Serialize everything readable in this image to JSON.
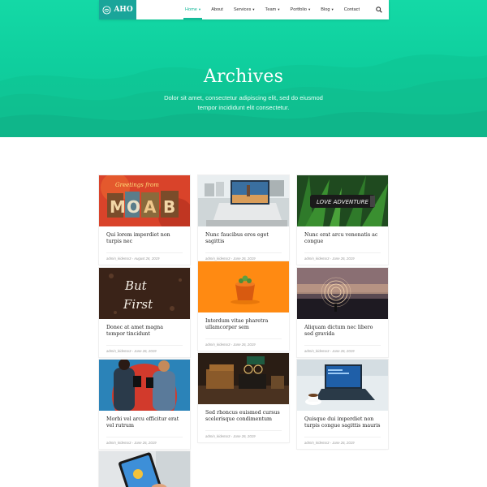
{
  "brand": {
    "name": "AHO",
    "accent": "#1aa59a",
    "hero_color": "#12d09f"
  },
  "nav": {
    "items": [
      {
        "label": "Home",
        "caret": "▾"
      },
      {
        "label": "About",
        "caret": ""
      },
      {
        "label": "Services",
        "caret": "▾"
      },
      {
        "label": "Team",
        "caret": "▾"
      },
      {
        "label": "Portfolio",
        "caret": "▾"
      },
      {
        "label": "Blog",
        "caret": "▾"
      },
      {
        "label": "Contact",
        "caret": ""
      }
    ],
    "active": "Home",
    "search_icon": "search-icon"
  },
  "hero": {
    "title": "Archives",
    "subtitle": "Dolor sit amet, consectetur adipiscing elit, sed do eiusmod tempor incididunt elit consectetur."
  },
  "posts": [
    {
      "title": "Qui lorem imperdiet non turpis nec",
      "meta": "admin_kidemo3 ◦ August 26, 2019",
      "image": "moab-postcard"
    },
    {
      "title": "Nunc faucibus eros eget sagittis",
      "meta": "admin_kidemo3 ◦ June 26, 2019",
      "image": "laptop-city"
    },
    {
      "title": "Nunc erat arcu venenatis ac congue",
      "meta": "admin_kidemo3 ◦ June 26, 2019",
      "image": "bottle-leaves"
    },
    {
      "title": "Donec at amet magna tempor tincidunt",
      "meta": "admin_kidemo3 ◦ June 26, 2019",
      "image": "but-first-coffee"
    },
    {
      "title": "Interdum vitae pharetra ullamcorper sem",
      "meta": "admin_kidemo3 ◦ June 26, 2019",
      "image": "orange-cup"
    },
    {
      "title": "Aliquam dictum nec libero sed gravida",
      "meta": "admin_kidemo3 ◦ June 26, 2019",
      "image": "light-painting-sunset"
    },
    {
      "title": "Morbi vel arcu efficitur erat vel rutrum",
      "meta": "admin_kidemo3 ◦ June 26, 2019",
      "image": "people-phones"
    },
    {
      "title": "Sed rhoncus euismod cursus scelerisque condimentum",
      "meta": "admin_kidemo3 ◦ June 26, 2019",
      "image": "vintage-desk"
    },
    {
      "title": "Quisque dui imperdiet non turpis congue sagittis mauris",
      "meta": "admin_kidemo3 ◦ June 26, 2019",
      "image": "laptop-coffee"
    },
    {
      "title": "",
      "meta": "",
      "image": "tablet-hand"
    }
  ]
}
